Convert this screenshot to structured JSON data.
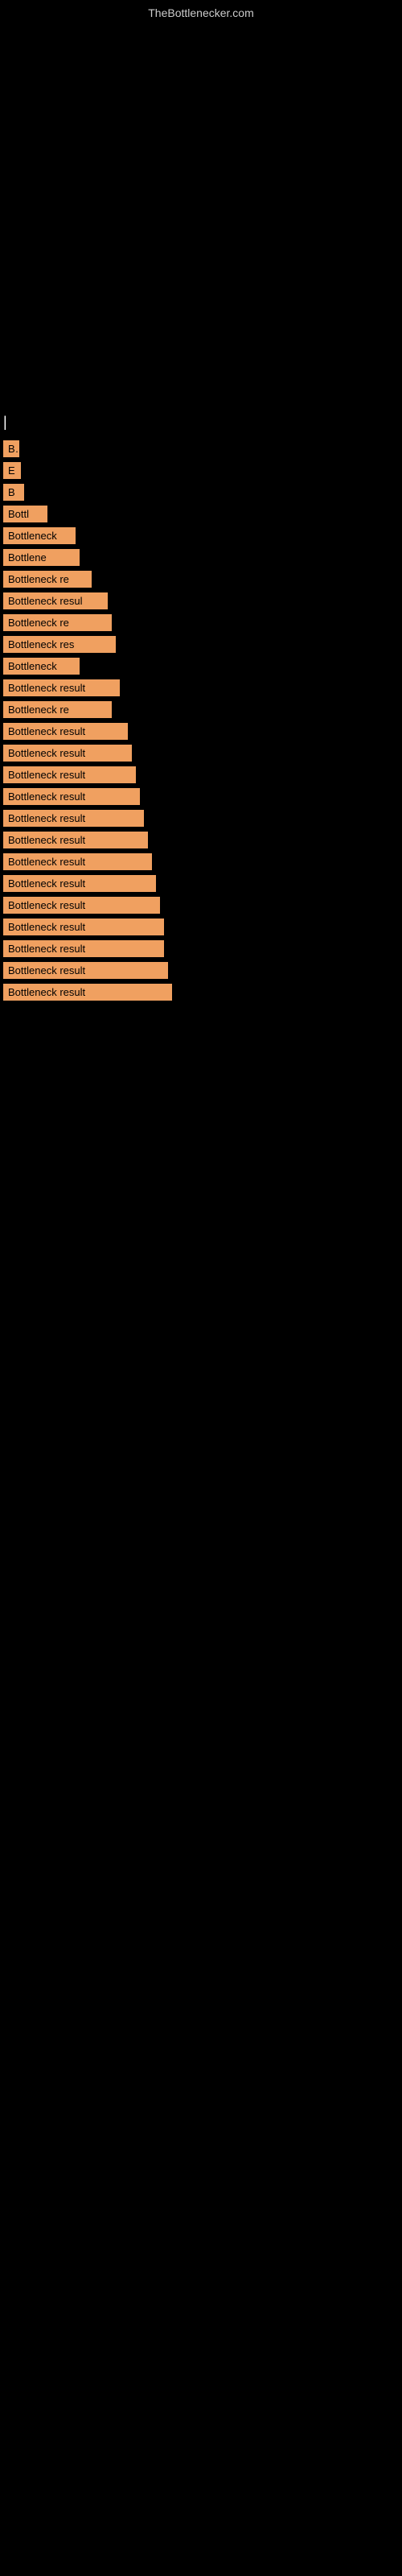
{
  "site": {
    "title": "TheBottlenecker.com"
  },
  "labels": {
    "bottleneck_result": "Bottleneck result"
  },
  "items": [
    {
      "id": 1,
      "text": "|",
      "width_class": "cursor-line"
    },
    {
      "id": 2,
      "text": "B",
      "width_class": "w-20"
    },
    {
      "id": 3,
      "text": "E",
      "width_class": "w-22"
    },
    {
      "id": 4,
      "text": "B",
      "width_class": "w-26"
    },
    {
      "id": 5,
      "text": "Bottl",
      "width_class": "w-55"
    },
    {
      "id": 6,
      "text": "Bottleneck",
      "width_class": "w-90"
    },
    {
      "id": 7,
      "text": "Bottlene",
      "width_class": "w-95"
    },
    {
      "id": 8,
      "text": "Bottleneck re",
      "width_class": "w-110"
    },
    {
      "id": 9,
      "text": "Bottleneck resul",
      "width_class": "w-130"
    },
    {
      "id": 10,
      "text": "Bottleneck re",
      "width_class": "w-135"
    },
    {
      "id": 11,
      "text": "Bottleneck res",
      "width_class": "w-140"
    },
    {
      "id": 12,
      "text": "Bottleneck",
      "width_class": "w-95"
    },
    {
      "id": 13,
      "text": "Bottleneck result",
      "width_class": "w-145"
    },
    {
      "id": 14,
      "text": "Bottleneck re",
      "width_class": "w-135"
    },
    {
      "id": 15,
      "text": "Bottleneck result",
      "width_class": "w-150"
    },
    {
      "id": 16,
      "text": "Bottleneck result",
      "width_class": "w-155"
    },
    {
      "id": 17,
      "text": "Bottleneck result",
      "width_class": "w-160"
    },
    {
      "id": 18,
      "text": "Bottleneck result",
      "width_class": "w-165"
    },
    {
      "id": 19,
      "text": "Bottleneck result",
      "width_class": "w-170"
    },
    {
      "id": 20,
      "text": "Bottleneck result",
      "width_class": "w-175"
    },
    {
      "id": 21,
      "text": "Bottleneck result",
      "width_class": "w-180"
    },
    {
      "id": 22,
      "text": "Bottleneck result",
      "width_class": "w-185"
    },
    {
      "id": 23,
      "text": "Bottleneck result",
      "width_class": "w-190"
    },
    {
      "id": 24,
      "text": "Bottleneck result",
      "width_class": "w-195"
    },
    {
      "id": 25,
      "text": "Bottleneck result",
      "width_class": "w-200"
    },
    {
      "id": 26,
      "text": "Bottleneck result",
      "width_class": "w-205"
    },
    {
      "id": 27,
      "text": "Bottleneck result",
      "width_class": "w-210"
    }
  ]
}
